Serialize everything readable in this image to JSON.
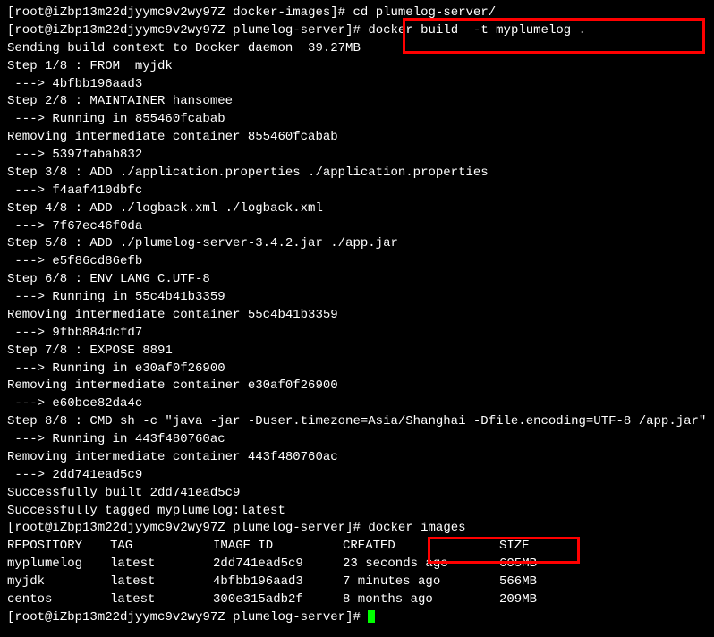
{
  "prompt_user": "root",
  "prompt_host": "iZbp13m22djyymc9v2wy97Z",
  "prompt_dir1": "docker-images",
  "prompt_dir2": "plumelog-server",
  "cmd1": "cd plumelog-server/",
  "cmd2": "docker build  -t myplumelog .",
  "cmd3": "docker images",
  "build": {
    "sending": "Sending build context to Docker daemon  39.27MB",
    "steps": [
      "Step 1/8 : FROM  myjdk",
      " ---> 4bfbb196aad3",
      "Step 2/8 : MAINTAINER hansomee",
      " ---> Running in 855460fcabab",
      "Removing intermediate container 855460fcabab",
      " ---> 5397fabab832",
      "Step 3/8 : ADD ./application.properties ./application.properties",
      " ---> f4aaf410dbfc",
      "Step 4/8 : ADD ./logback.xml ./logback.xml",
      " ---> 7f67ec46f0da",
      "Step 5/8 : ADD ./plumelog-server-3.4.2.jar ./app.jar",
      " ---> e5f86cd86efb",
      "Step 6/8 : ENV LANG C.UTF-8",
      " ---> Running in 55c4b41b3359",
      "Removing intermediate container 55c4b41b3359",
      " ---> 9fbb884dcfd7",
      "Step 7/8 : EXPOSE 8891",
      " ---> Running in e30af0f26900",
      "Removing intermediate container e30af0f26900",
      " ---> e60bce82da4c",
      "Step 8/8 : CMD sh -c \"java -jar -Duser.timezone=Asia/Shanghai -Dfile.encoding=UTF-8 /app.jar\"",
      " ---> Running in 443f480760ac",
      "Removing intermediate container 443f480760ac",
      " ---> 2dd741ead5c9",
      "Successfully built 2dd741ead5c9",
      "Successfully tagged myplumelog:latest"
    ]
  },
  "images_table": {
    "headers": {
      "repository": "REPOSITORY",
      "tag": "TAG",
      "image_id": "IMAGE ID",
      "created": "CREATED",
      "size": "SIZE"
    },
    "rows": [
      {
        "repository": "myplumelog",
        "tag": "latest",
        "image_id": "2dd741ead5c9",
        "created": "23 seconds ago",
        "size": "605MB"
      },
      {
        "repository": "myjdk",
        "tag": "latest",
        "image_id": "4bfbb196aad3",
        "created": "7 minutes ago",
        "size": "566MB"
      },
      {
        "repository": "centos",
        "tag": "latest",
        "image_id": "300e315adb2f",
        "created": "8 months ago",
        "size": "209MB"
      }
    ]
  }
}
